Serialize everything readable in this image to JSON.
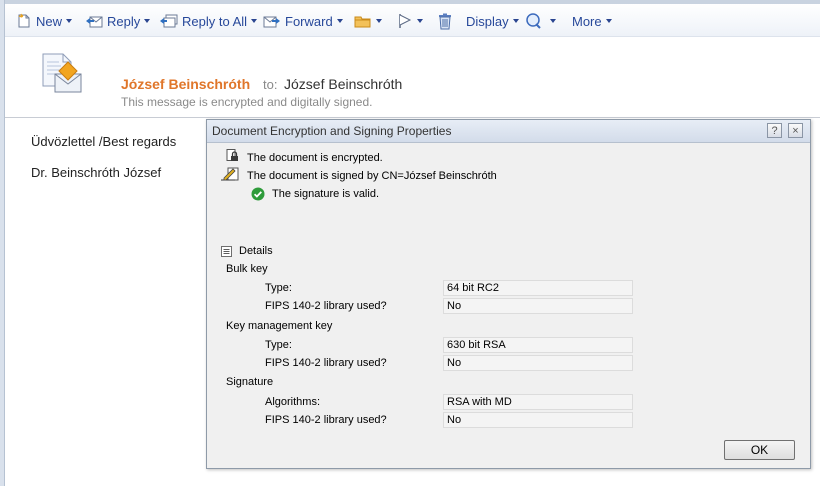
{
  "toolbar": {
    "new": "New",
    "reply": "Reply",
    "reply_all": "Reply to All",
    "forward": "Forward",
    "display": "Display",
    "more": "More"
  },
  "message": {
    "sender": "József Beinschróth",
    "to_label": "to:",
    "to": "József Beinschróth",
    "encryption_note": "This message is encrypted and digitally signed.",
    "body_lines": [
      "Üdvözlettel /Best regards",
      "Dr. Beinschróth József"
    ]
  },
  "dialog": {
    "title": "Document Encryption and Signing Properties",
    "help": "?",
    "close": "×",
    "status": {
      "encrypted": "The document is encrypted.",
      "signed": "The document is signed by CN=József Beinschróth",
      "valid": "The signature is valid."
    },
    "details_label": "Details",
    "sections": [
      {
        "heading": "Bulk key",
        "rows": [
          {
            "label": "Type:",
            "value": "64 bit RC2"
          },
          {
            "label": "FIPS 140-2 library used?",
            "value": "No"
          }
        ]
      },
      {
        "heading": "Key management key",
        "rows": [
          {
            "label": "Type:",
            "value": "630 bit RSA"
          },
          {
            "label": "FIPS 140-2 library used?",
            "value": "No"
          }
        ]
      },
      {
        "heading": "Signature",
        "rows": [
          {
            "label": "Algorithms:",
            "value": "RSA with MD"
          },
          {
            "label": "FIPS 140-2 library used?",
            "value": "No"
          }
        ]
      }
    ],
    "ok": "OK"
  },
  "colors": {
    "toolbar_text": "#27489a",
    "sender": "#e0762a",
    "valid_check": "#2e9b3a"
  },
  "icons": [
    "new-document-icon",
    "reply-icon",
    "reply-all-icon",
    "forward-icon",
    "folder-icon",
    "flag-icon",
    "trash-icon",
    "search-bubble-icon",
    "encrypted-envelope-icon",
    "lock-icon",
    "signature-pen-icon",
    "check-icon",
    "collapse-icon"
  ]
}
